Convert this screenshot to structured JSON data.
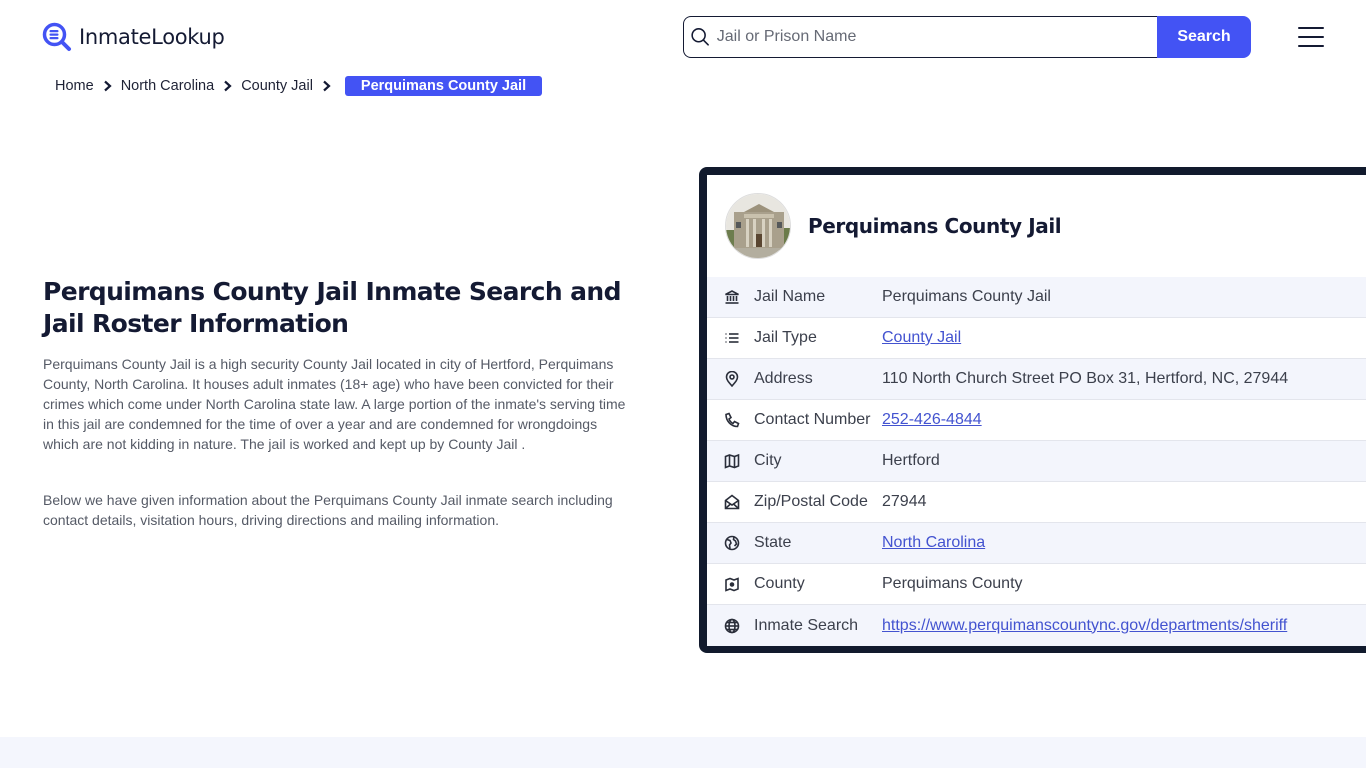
{
  "header": {
    "logo_text": "InmateLookup",
    "search_placeholder": "Jail or Prison Name",
    "search_value": "",
    "search_button": "Search",
    "accent": "#4353f4"
  },
  "breadcrumb": {
    "items": [
      "Home",
      "North Carolina",
      "County Jail"
    ],
    "current": "Perquimans County Jail"
  },
  "intro": {
    "title": "Perquimans County Jail Inmate Search and Jail Roster Information",
    "paragraph1": "Perquimans County Jail is a high security County Jail located in city of Hertford, Perquimans County, North Carolina. It houses adult inmates (18+ age) who have been convicted for their crimes which come under North Carolina state law. A large portion of the inmate's serving time in this jail are condemned for the time of over a year and are condemned for wrongdoings which are not kidding in nature. The jail is worked and kept up by County Jail .",
    "paragraph2": "Below we have given information about the Perquimans County Jail inmate search including contact details, visitation hours, driving directions and mailing information."
  },
  "card": {
    "title": "Perquimans County Jail",
    "rows": [
      {
        "icon": "bank-icon",
        "label": "Jail Name",
        "value": "Perquimans County Jail",
        "link": false
      },
      {
        "icon": "list-icon",
        "label": "Jail Type",
        "value": "County Jail",
        "link": true
      },
      {
        "icon": "map-pin-icon",
        "label": "Address",
        "value": "110 North Church Street PO Box 31, Hertford, NC, 27944",
        "link": false
      },
      {
        "icon": "phone-icon",
        "label": "Contact Number",
        "value": "252-426-4844",
        "link": true
      },
      {
        "icon": "map-icon",
        "label": "City",
        "value": "Hertford",
        "link": false
      },
      {
        "icon": "mail-open-icon",
        "label": "Zip/Postal Code",
        "value": "27944",
        "link": false
      },
      {
        "icon": "earth-icon",
        "label": "State",
        "value": "North Carolina",
        "link": true
      },
      {
        "icon": "county-map-icon",
        "label": "County",
        "value": "Perquimans County",
        "link": false
      },
      {
        "icon": "globe-icon",
        "label": "Inmate Search",
        "value": "https://www.perquimanscountync.gov/departments/sheriff",
        "link": true
      }
    ]
  }
}
